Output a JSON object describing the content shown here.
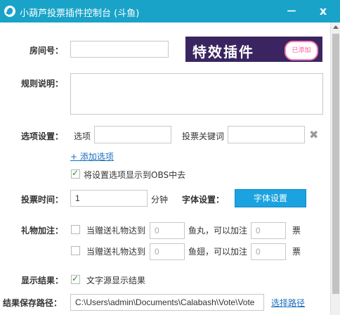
{
  "title": "小葫芦投票插件控制台 (斗鱼)",
  "window_controls": {
    "minimize": "－",
    "close": "x"
  },
  "banner": {
    "text": "特效插件",
    "badge": "已添加"
  },
  "room": {
    "label": "房间号：",
    "value": ""
  },
  "rules": {
    "label": "规则说明：",
    "value": ""
  },
  "options": {
    "label": "选项设置：",
    "option_label": "选项",
    "option_value": "",
    "keyword_label": "投票关键词",
    "keyword_value": "",
    "remove_icon": "✖",
    "add_link": "+ 添加选项",
    "show_obs_label": "将设置选项显示到OBS中去",
    "show_obs_checked": true
  },
  "vote_time": {
    "label": "投票时间：",
    "value": "1",
    "unit": "分钟"
  },
  "font": {
    "label": "字体设置：",
    "button": "字体设置"
  },
  "gift": {
    "label": "礼物加注：",
    "rows": [
      {
        "prefix": "当赠送礼物达到",
        "count": "0",
        "mid": "鱼丸，可以加注",
        "votes": "0",
        "suffix": "票",
        "checked": false
      },
      {
        "prefix": "当赠送礼物达到",
        "count": "0",
        "mid": "鱼翅，可以加注",
        "votes": "0",
        "suffix": "票",
        "checked": false
      }
    ]
  },
  "result": {
    "label": "显示结果：",
    "checkbox_label": "文字源显示结果",
    "checked": true
  },
  "save_path": {
    "label": "结果保存路径：",
    "value": "C:\\Users\\admin\\Documents\\Calabash\\Vote\\Vote",
    "link": "选择路径"
  },
  "colors": {
    "titlebar": "#1aa3c8",
    "button": "#1aa3e0",
    "link": "#1a6fc0"
  }
}
